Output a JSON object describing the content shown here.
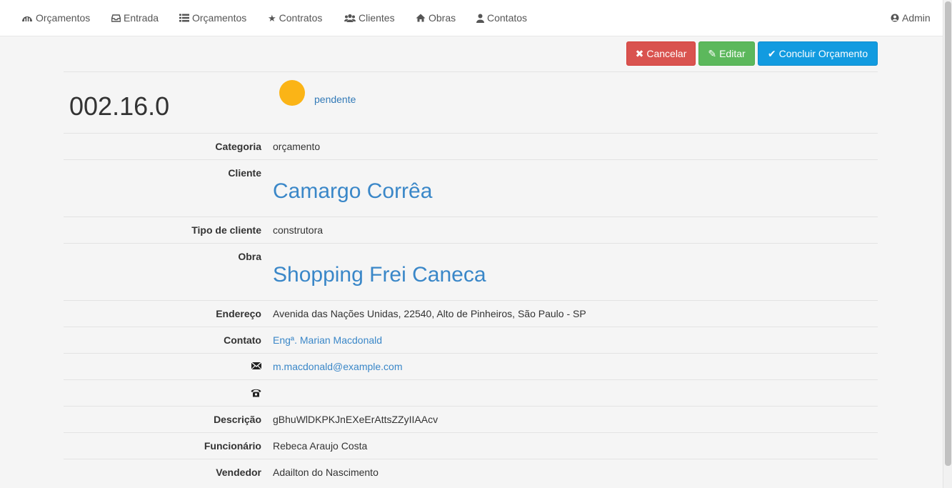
{
  "nav": {
    "items": [
      {
        "label": "Orçamentos",
        "icon": "dashboard-icon"
      },
      {
        "label": "Entrada",
        "icon": "inbox-icon"
      },
      {
        "label": "Orçamentos",
        "icon": "list-icon"
      },
      {
        "label": "Contratos",
        "icon": "star-icon"
      },
      {
        "label": "Clientes",
        "icon": "users-icon"
      },
      {
        "label": "Obras",
        "icon": "home-icon"
      },
      {
        "label": "Contatos",
        "icon": "user-icon"
      }
    ],
    "admin": {
      "label": "Admin",
      "icon": "user-circle-icon"
    }
  },
  "actions": {
    "cancel_label": "Cancelar",
    "edit_label": "Editar",
    "finish_label": "Concluir Orçamento"
  },
  "budget": {
    "code": "002.16.0",
    "status": "pendente",
    "status_color": "#fbb416"
  },
  "details": {
    "categoria": {
      "label": "Categoria",
      "value": "orçamento"
    },
    "cliente": {
      "label": "Cliente",
      "value": "Camargo Corrêa"
    },
    "tipo_cliente": {
      "label": "Tipo de cliente",
      "value": "construtora"
    },
    "obra": {
      "label": "Obra",
      "value": "Shopping Frei Caneca"
    },
    "endereco": {
      "label": "Endereço",
      "value": "Avenida das Nações Unidas, 22540, Alto de Pinheiros, São Paulo - SP"
    },
    "contato": {
      "label": "Contato",
      "value": "Engª. Marian Macdonald"
    },
    "email": {
      "icon": "envelope-icon",
      "value": "m.macdonald@example.com"
    },
    "telefone": {
      "icon": "phone-icon",
      "value": ""
    },
    "descricao": {
      "label": "Descrição",
      "value": "gBhuWlDKPKJnEXeErAttsZZyIIAAcv"
    },
    "funcionario": {
      "label": "Funcionário",
      "value": "Rebeca Araujo Costa"
    },
    "vendedor": {
      "label": "Vendedor",
      "value": "Adailton do Nascimento"
    }
  }
}
